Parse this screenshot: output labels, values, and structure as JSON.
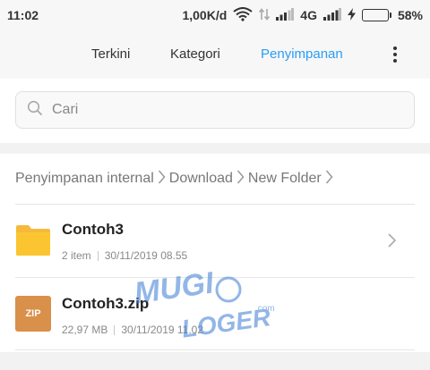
{
  "status_bar": {
    "time": "11:02",
    "net_speed": "1,00K/d",
    "network_type": "4G",
    "battery_percent": "58%",
    "battery_level": 0.58,
    "battery_color": "#2ecc40"
  },
  "tabs": [
    {
      "label": "Terkini",
      "active": false
    },
    {
      "label": "Kategori",
      "active": false
    },
    {
      "label": "Penyimpanan",
      "active": true
    }
  ],
  "accent_color": "#2a9df4",
  "search": {
    "placeholder": "Cari",
    "value": ""
  },
  "breadcrumb": [
    "Penyimpanan internal",
    "Download",
    "New Folder"
  ],
  "files": [
    {
      "name": "Contoh3",
      "info": "2 item",
      "date": "30/11/2019 08.55",
      "icon": "folder-icon",
      "has_arrow": true
    },
    {
      "name": "Contoh3.zip",
      "info": "22,97 MB",
      "date": "30/11/2019 11.02",
      "icon": "zip-file-icon",
      "icon_label": "ZIP"
    }
  ],
  "watermark": {
    "line1": "MUGI",
    "line2": "LOGER",
    "suffix": ".com"
  }
}
